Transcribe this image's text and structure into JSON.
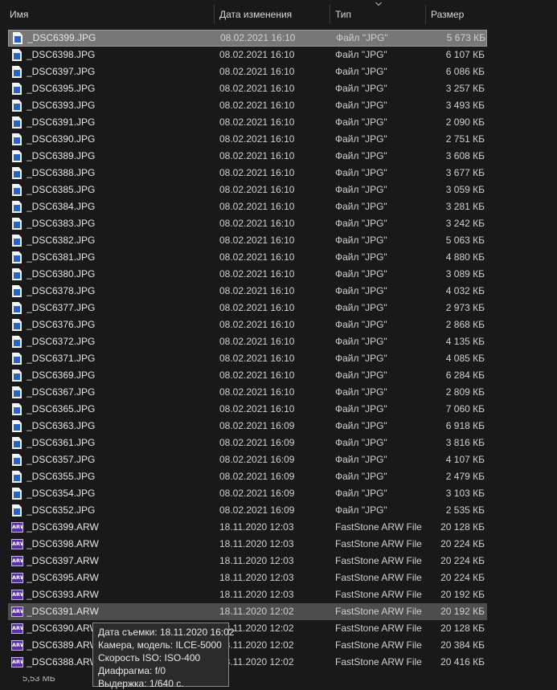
{
  "columns": {
    "name": "Имя",
    "date": "Дата изменения",
    "type": "Тип",
    "size": "Размер"
  },
  "sort_icon": "chevron-down-icon",
  "files": [
    {
      "name": "_DSC6399.JPG",
      "date": "08.02.2021 16:10",
      "type": "Файл \"JPG\"",
      "size": "5 673 КБ",
      "kind": "jpg",
      "state": "selected"
    },
    {
      "name": "_DSC6398.JPG",
      "date": "08.02.2021 16:10",
      "type": "Файл \"JPG\"",
      "size": "6 107 КБ",
      "kind": "jpg"
    },
    {
      "name": "_DSC6397.JPG",
      "date": "08.02.2021 16:10",
      "type": "Файл \"JPG\"",
      "size": "6 086 КБ",
      "kind": "jpg"
    },
    {
      "name": "_DSC6395.JPG",
      "date": "08.02.2021 16:10",
      "type": "Файл \"JPG\"",
      "size": "3 257 КБ",
      "kind": "jpg"
    },
    {
      "name": "_DSC6393.JPG",
      "date": "08.02.2021 16:10",
      "type": "Файл \"JPG\"",
      "size": "3 493 КБ",
      "kind": "jpg"
    },
    {
      "name": "_DSC6391.JPG",
      "date": "08.02.2021 16:10",
      "type": "Файл \"JPG\"",
      "size": "2 090 КБ",
      "kind": "jpg"
    },
    {
      "name": "_DSC6390.JPG",
      "date": "08.02.2021 16:10",
      "type": "Файл \"JPG\"",
      "size": "2 751 КБ",
      "kind": "jpg"
    },
    {
      "name": "_DSC6389.JPG",
      "date": "08.02.2021 16:10",
      "type": "Файл \"JPG\"",
      "size": "3 608 КБ",
      "kind": "jpg"
    },
    {
      "name": "_DSC6388.JPG",
      "date": "08.02.2021 16:10",
      "type": "Файл \"JPG\"",
      "size": "3 677 КБ",
      "kind": "jpg"
    },
    {
      "name": "_DSC6385.JPG",
      "date": "08.02.2021 16:10",
      "type": "Файл \"JPG\"",
      "size": "3 059 КБ",
      "kind": "jpg"
    },
    {
      "name": "_DSC6384.JPG",
      "date": "08.02.2021 16:10",
      "type": "Файл \"JPG\"",
      "size": "3 281 КБ",
      "kind": "jpg"
    },
    {
      "name": "_DSC6383.JPG",
      "date": "08.02.2021 16:10",
      "type": "Файл \"JPG\"",
      "size": "3 242 КБ",
      "kind": "jpg"
    },
    {
      "name": "_DSC6382.JPG",
      "date": "08.02.2021 16:10",
      "type": "Файл \"JPG\"",
      "size": "5 063 КБ",
      "kind": "jpg"
    },
    {
      "name": "_DSC6381.JPG",
      "date": "08.02.2021 16:10",
      "type": "Файл \"JPG\"",
      "size": "4 880 КБ",
      "kind": "jpg"
    },
    {
      "name": "_DSC6380.JPG",
      "date": "08.02.2021 16:10",
      "type": "Файл \"JPG\"",
      "size": "3 089 КБ",
      "kind": "jpg"
    },
    {
      "name": "_DSC6378.JPG",
      "date": "08.02.2021 16:10",
      "type": "Файл \"JPG\"",
      "size": "4 032 КБ",
      "kind": "jpg"
    },
    {
      "name": "_DSC6377.JPG",
      "date": "08.02.2021 16:10",
      "type": "Файл \"JPG\"",
      "size": "2 973 КБ",
      "kind": "jpg"
    },
    {
      "name": "_DSC6376.JPG",
      "date": "08.02.2021 16:10",
      "type": "Файл \"JPG\"",
      "size": "2 868 КБ",
      "kind": "jpg"
    },
    {
      "name": "_DSC6372.JPG",
      "date": "08.02.2021 16:10",
      "type": "Файл \"JPG\"",
      "size": "4 135 КБ",
      "kind": "jpg"
    },
    {
      "name": "_DSC6371.JPG",
      "date": "08.02.2021 16:10",
      "type": "Файл \"JPG\"",
      "size": "4 085 КБ",
      "kind": "jpg"
    },
    {
      "name": "_DSC6369.JPG",
      "date": "08.02.2021 16:10",
      "type": "Файл \"JPG\"",
      "size": "6 284 КБ",
      "kind": "jpg"
    },
    {
      "name": "_DSC6367.JPG",
      "date": "08.02.2021 16:10",
      "type": "Файл \"JPG\"",
      "size": "2 809 КБ",
      "kind": "jpg"
    },
    {
      "name": "_DSC6365.JPG",
      "date": "08.02.2021 16:10",
      "type": "Файл \"JPG\"",
      "size": "7 060 КБ",
      "kind": "jpg"
    },
    {
      "name": "_DSC6363.JPG",
      "date": "08.02.2021 16:09",
      "type": "Файл \"JPG\"",
      "size": "6 918 КБ",
      "kind": "jpg"
    },
    {
      "name": "_DSC6361.JPG",
      "date": "08.02.2021 16:09",
      "type": "Файл \"JPG\"",
      "size": "3 816 КБ",
      "kind": "jpg"
    },
    {
      "name": "_DSC6357.JPG",
      "date": "08.02.2021 16:09",
      "type": "Файл \"JPG\"",
      "size": "4 107 КБ",
      "kind": "jpg"
    },
    {
      "name": "_DSC6355.JPG",
      "date": "08.02.2021 16:09",
      "type": "Файл \"JPG\"",
      "size": "2 479 КБ",
      "kind": "jpg"
    },
    {
      "name": "_DSC6354.JPG",
      "date": "08.02.2021 16:09",
      "type": "Файл \"JPG\"",
      "size": "3 103 КБ",
      "kind": "jpg"
    },
    {
      "name": "_DSC6352.JPG",
      "date": "08.02.2021 16:09",
      "type": "Файл \"JPG\"",
      "size": "2 535 КБ",
      "kind": "jpg"
    },
    {
      "name": "_DSC6399.ARW",
      "date": "18.11.2020 12:03",
      "type": "FastStone ARW File",
      "size": "20 128 КБ",
      "kind": "arw"
    },
    {
      "name": "_DSC6398.ARW",
      "date": "18.11.2020 12:03",
      "type": "FastStone ARW File",
      "size": "20 224 КБ",
      "kind": "arw"
    },
    {
      "name": "_DSC6397.ARW",
      "date": "18.11.2020 12:03",
      "type": "FastStone ARW File",
      "size": "20 224 КБ",
      "kind": "arw"
    },
    {
      "name": "_DSC6395.ARW",
      "date": "18.11.2020 12:03",
      "type": "FastStone ARW File",
      "size": "20 224 КБ",
      "kind": "arw"
    },
    {
      "name": "_DSC6393.ARW",
      "date": "18.11.2020 12:03",
      "type": "FastStone ARW File",
      "size": "20 192 КБ",
      "kind": "arw"
    },
    {
      "name": "_DSC6391.ARW",
      "date": "18.11.2020 12:02",
      "type": "FastStone ARW File",
      "size": "20 192 КБ",
      "kind": "arw",
      "state": "hover"
    },
    {
      "name": "_DSC6390.ARW",
      "date": "18.11.2020 12:02",
      "type": "FastStone ARW File",
      "size": "20 128 КБ",
      "kind": "arw"
    },
    {
      "name": "_DSC6389.ARW",
      "date": "18.11.2020 12:02",
      "type": "FastStone ARW File",
      "size": "20 384 КБ",
      "kind": "arw"
    },
    {
      "name": "_DSC6388.ARW",
      "date": "18.11.2020 12:02",
      "type": "FastStone ARW File",
      "size": "20 416 КБ",
      "kind": "arw"
    }
  ],
  "arw_icon_label": "ARW",
  "tooltip": {
    "lines": [
      "Дата съемки: 18.11.2020 16:02",
      "Камера, модель: ILCE-5000",
      "Скорость ISO: ISO-400",
      "Диафрагма: f/0",
      "Выдержка: 1/640 с."
    ]
  },
  "status": {
    "text": "5,53 МБ"
  },
  "colors": {
    "background": "#191919",
    "selected_row": "#777777",
    "hover_row": "#4d4d4d",
    "jpg_icon_accent": "#2a62c6",
    "arw_icon": "#5a2fa3"
  }
}
